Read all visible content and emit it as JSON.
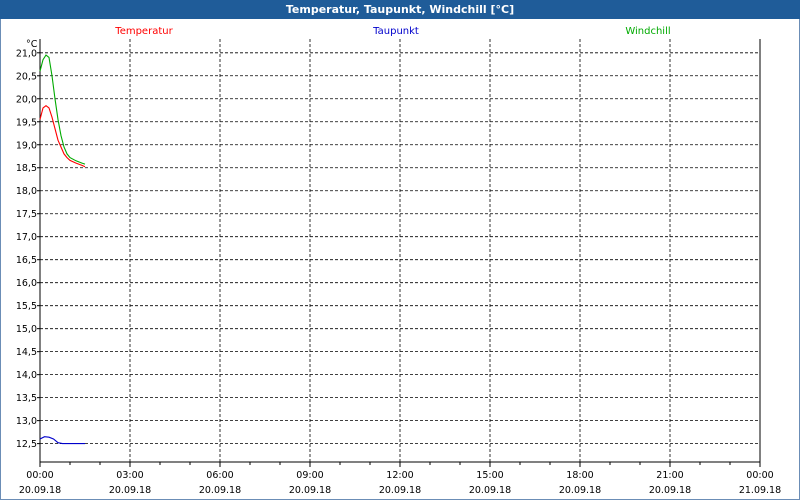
{
  "window": {
    "title": "Temperatur, Taupunkt, Windchill [°C]"
  },
  "chart_data": {
    "type": "line",
    "title": "Temperatur, Taupunkt, Windchill [°C]",
    "ylabel": "°C",
    "ylim": [
      12.1,
      21.3
    ],
    "yticks": [
      "12,5",
      "13,0",
      "13,5",
      "14,0",
      "14,5",
      "15,0",
      "15,5",
      "16,0",
      "16,5",
      "17,0",
      "17,5",
      "18,0",
      "18,5",
      "19,0",
      "19,5",
      "20,0",
      "20,5",
      "21,0"
    ],
    "xlim_hours": [
      0,
      24
    ],
    "xticks": [
      {
        "time": "00:00",
        "date": "20.09.18"
      },
      {
        "time": "03:00",
        "date": "20.09.18"
      },
      {
        "time": "06:00",
        "date": "20.09.18"
      },
      {
        "time": "09:00",
        "date": "20.09.18"
      },
      {
        "time": "12:00",
        "date": "20.09.18"
      },
      {
        "time": "15:00",
        "date": "20.09.18"
      },
      {
        "time": "18:00",
        "date": "20.09.18"
      },
      {
        "time": "21:00",
        "date": "20.09.18"
      },
      {
        "time": "00:00",
        "date": "21.09.18"
      }
    ],
    "grid": true,
    "legend_position": "top",
    "series": [
      {
        "name": "Temperatur",
        "color": "#ff0000",
        "x": [
          0.0,
          0.1,
          0.2,
          0.3,
          0.4,
          0.5,
          0.6,
          0.7,
          0.8,
          0.9,
          1.0,
          1.2,
          1.4,
          1.5
        ],
        "y": [
          19.55,
          19.8,
          19.85,
          19.8,
          19.6,
          19.35,
          19.1,
          18.95,
          18.8,
          18.72,
          18.66,
          18.6,
          18.55,
          18.52
        ]
      },
      {
        "name": "Taupunkt",
        "color": "#0000cc",
        "x": [
          0.0,
          0.15,
          0.3,
          0.45,
          0.6,
          0.75,
          1.0,
          1.25,
          1.5
        ],
        "y": [
          12.6,
          12.65,
          12.64,
          12.6,
          12.52,
          12.5,
          12.5,
          12.5,
          12.5
        ]
      },
      {
        "name": "Windchill",
        "color": "#00aa00",
        "x": [
          0.0,
          0.1,
          0.2,
          0.3,
          0.4,
          0.5,
          0.6,
          0.7,
          0.8,
          0.9,
          1.0,
          1.2,
          1.4,
          1.5
        ],
        "y": [
          20.6,
          20.85,
          20.95,
          20.9,
          20.5,
          20.0,
          19.55,
          19.2,
          18.95,
          18.8,
          18.72,
          18.65,
          18.6,
          18.58
        ]
      }
    ]
  }
}
